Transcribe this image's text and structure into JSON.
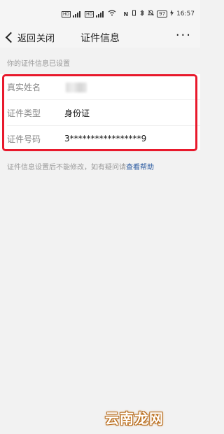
{
  "status_bar": {
    "left_icons": [
      "hd-icon",
      "signal-icon",
      "hd-icon",
      "signal-icon",
      "wifi-icon"
    ],
    "right_icons": [
      "nfc-icon",
      "vibrate-icon",
      "bluetooth-icon",
      "mute-icon"
    ],
    "battery": "97",
    "time": "16:57"
  },
  "nav": {
    "back_label": "返回",
    "close_label": "关闭",
    "title": "证件信息",
    "more_label": "···"
  },
  "notice": "你的证件信息已设置",
  "rows": [
    {
      "label": "真实姓名",
      "value": ""
    },
    {
      "label": "证件类型",
      "value": "身份证"
    },
    {
      "label": "证件号码",
      "value": "3*****************9"
    }
  ],
  "footer": {
    "text": "证件信息设置后不能修改，如有疑问请",
    "link": "查看帮助"
  },
  "watermark": "云南龙网",
  "colors": {
    "highlight_border": "#e8192c",
    "link": "#2a5aa0"
  }
}
